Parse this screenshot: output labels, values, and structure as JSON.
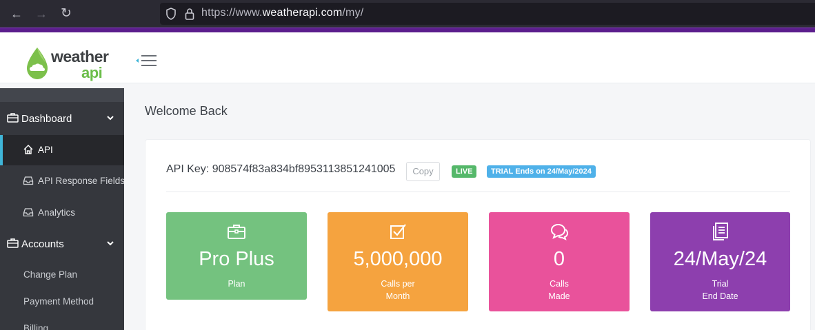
{
  "browser": {
    "url_prefix": "https://www.",
    "url_host": "weatherapi.com",
    "url_path": "/my/"
  },
  "header": {
    "logo_line1": "weather",
    "logo_line2": "api"
  },
  "sidebar": {
    "dashboard_label": "Dashboard",
    "items": [
      {
        "label": "API"
      },
      {
        "label": "API Response Fields"
      },
      {
        "label": "Analytics"
      }
    ],
    "accounts_label": "Accounts",
    "account_items": [
      {
        "label": "Change Plan"
      },
      {
        "label": "Payment Method"
      },
      {
        "label": "Billing"
      }
    ]
  },
  "main": {
    "title": "Welcome Back",
    "api_key_text": "API Key: 908574f83a834bf8953113851241005",
    "copy_label": "Copy",
    "live_badge": "LIVE",
    "trial_badge": "TRIAL Ends on 24/May/2024",
    "tiles": [
      {
        "value": "Pro Plus",
        "label_line1": "Plan",
        "label_line2": "",
        "icon": "briefcase-icon",
        "color": "#74c27f"
      },
      {
        "value": "5,000,000",
        "label_line1": "Calls per",
        "label_line2": "Month",
        "icon": "checkbox-icon",
        "color": "#f5a33f"
      },
      {
        "value": "0",
        "label_line1": "Calls",
        "label_line2": "Made",
        "icon": "chat-bubbles-icon",
        "color": "#e9529b"
      },
      {
        "value": "24/May/24",
        "label_line1": "Trial",
        "label_line2": "End Date",
        "icon": "document-icon",
        "color": "#8d3fae"
      }
    ]
  },
  "colors": {
    "sidebar_bg": "#35373d",
    "active_accent": "#3fb5d8",
    "brand_green": "#6cbe4a",
    "browser_accent": "#5b1d8c"
  }
}
